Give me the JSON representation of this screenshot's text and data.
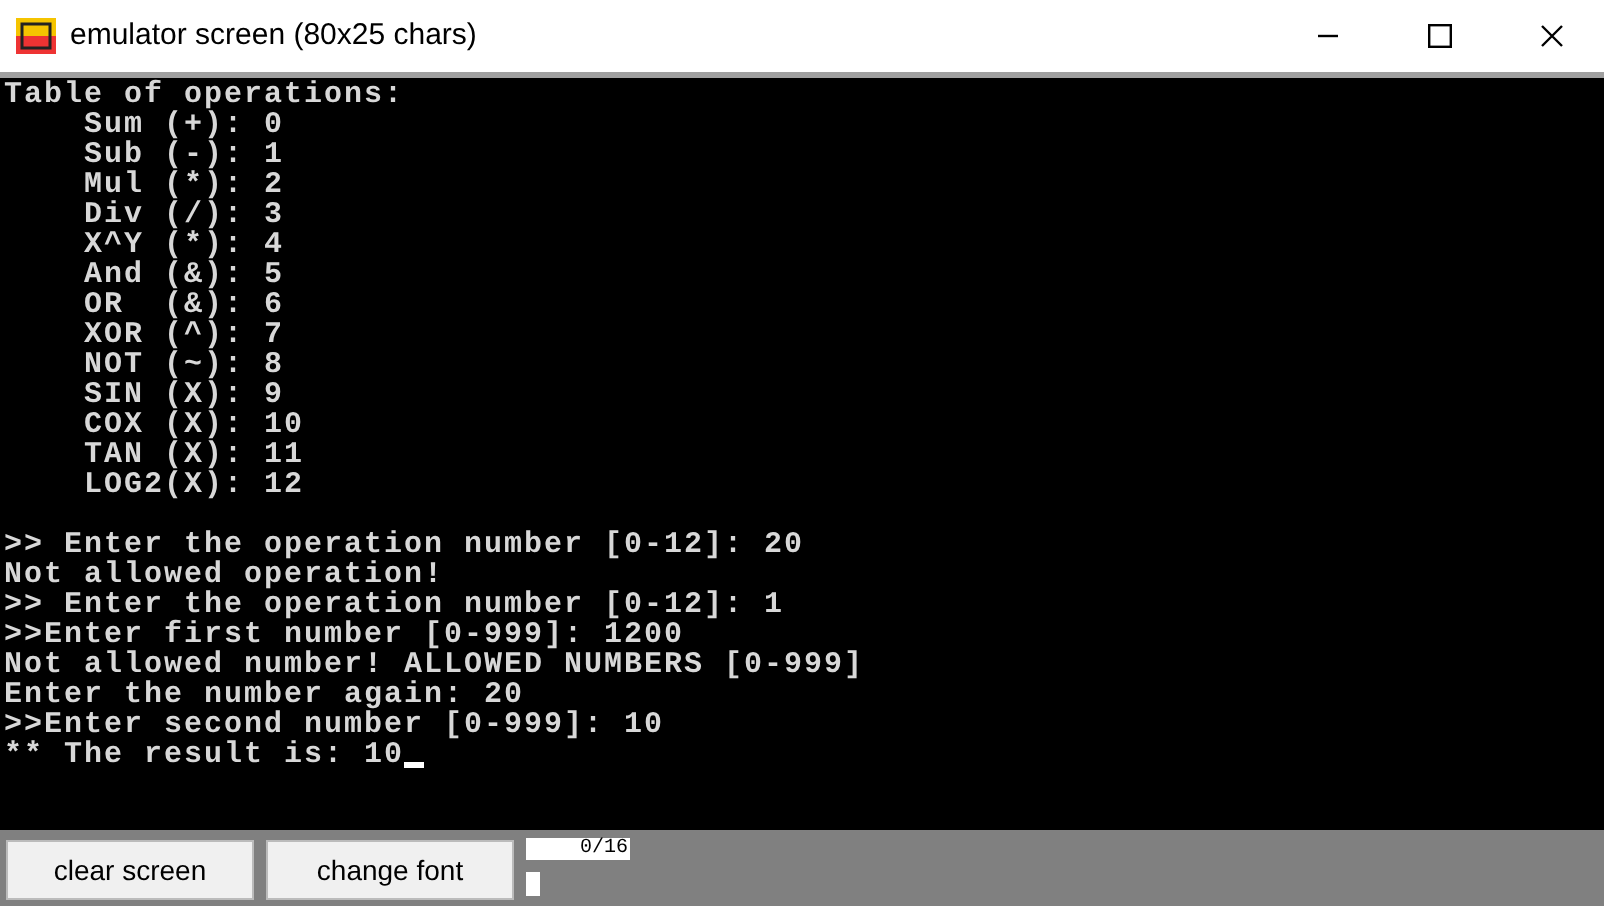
{
  "window": {
    "title": "emulator screen (80x25 chars)"
  },
  "console": {
    "table_title": "Table of operations:",
    "table_rows": [
      "    Sum (+): 0",
      "    Sub (-): 1",
      "    Mul (*): 2",
      "    Div (/): 3",
      "    X^Y (*): 4",
      "    And (&): 5",
      "    OR  (&): 6",
      "    XOR (^): 7",
      "    NOT (~): 8",
      "    SIN (X): 9",
      "    COX (X): 10",
      "    TAN (X): 11",
      "    LOG2(X): 12"
    ],
    "log_lines": [
      ">> Enter the operation number [0-12]: 20",
      "Not allowed operation!",
      ">> Enter the operation number [0-12]: 1",
      ">>Enter first number [0-999]: 1200",
      "Not allowed number! ALLOWED NUMBERS [0-999]",
      "Enter the number again: 20",
      ">>Enter second number [0-999]: 10",
      "** The result is: 10"
    ]
  },
  "buttons": [
    "clear screen",
    "change font"
  ],
  "counter": "0/16"
}
